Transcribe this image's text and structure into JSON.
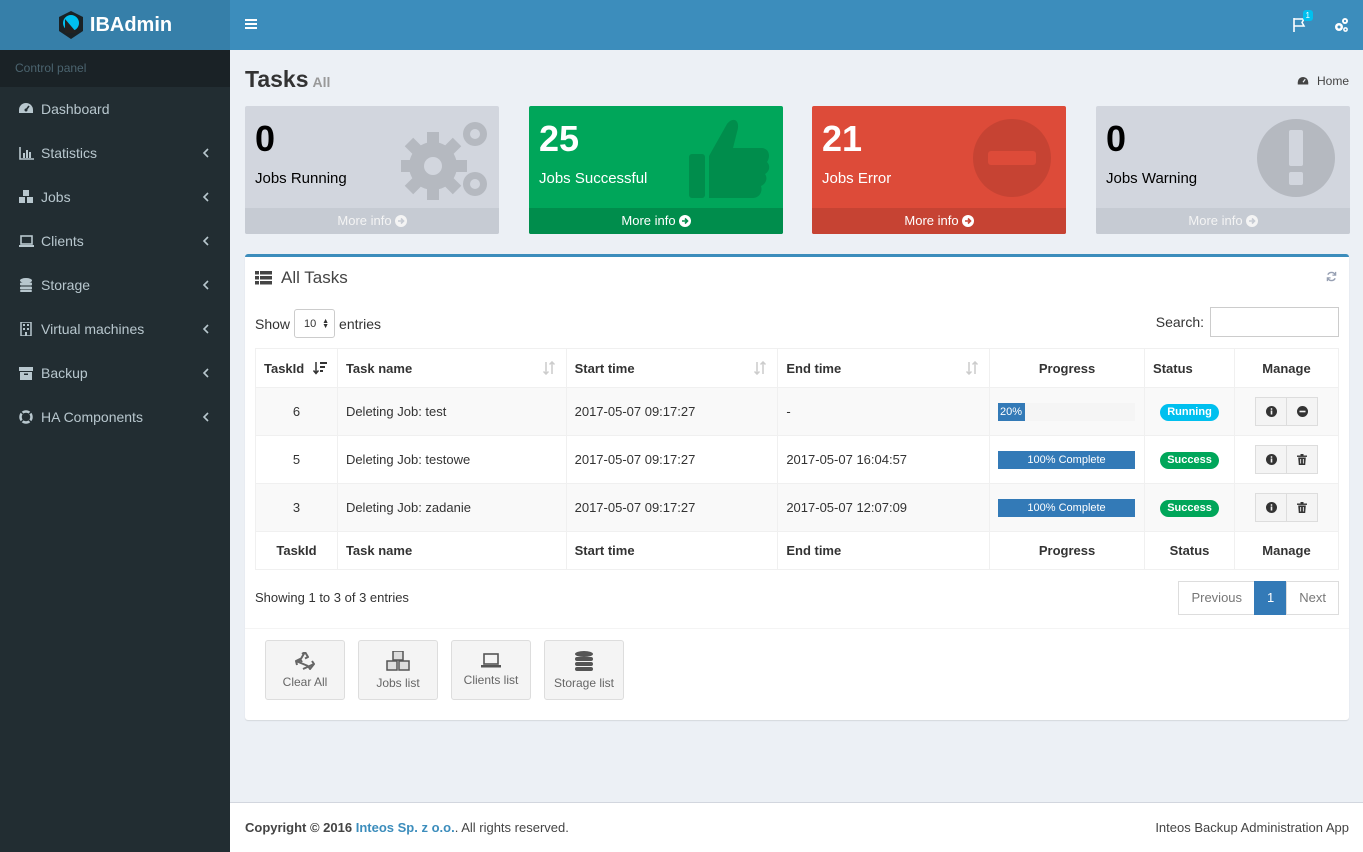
{
  "app": {
    "name": "IBAdmin"
  },
  "sidebar": {
    "header": "Control panel",
    "items": [
      {
        "label": "Dashboard",
        "icon": "dashboard-icon",
        "has_children": false
      },
      {
        "label": "Statistics",
        "icon": "bar-chart-icon",
        "has_children": true
      },
      {
        "label": "Jobs",
        "icon": "cubes-icon",
        "has_children": true
      },
      {
        "label": "Clients",
        "icon": "laptop-icon",
        "has_children": true
      },
      {
        "label": "Storage",
        "icon": "database-icon",
        "has_children": true
      },
      {
        "label": "Virtual machines",
        "icon": "building-icon",
        "has_children": true
      },
      {
        "label": "Backup",
        "icon": "archive-icon",
        "has_children": true
      },
      {
        "label": "HA Components",
        "icon": "life-ring-icon",
        "has_children": true
      }
    ]
  },
  "header": {
    "notification_count": "1"
  },
  "page": {
    "title": "Tasks",
    "subtitle": "All"
  },
  "breadcrumb": {
    "home": "Home"
  },
  "stats": [
    {
      "value": "0",
      "label": "Jobs Running",
      "more": "More info",
      "color": "#d2d6de",
      "icon": "gears-icon"
    },
    {
      "value": "25",
      "label": "Jobs Successful",
      "more": "More info",
      "color": "#00a65a",
      "icon": "thumbs-up-icon"
    },
    {
      "value": "21",
      "label": "Jobs Error",
      "more": "More info",
      "color": "#dd4b39",
      "icon": "minus-circle-icon"
    },
    {
      "value": "0",
      "label": "Jobs Warning",
      "more": "More info",
      "color": "#d2d6de",
      "icon": "exclamation-circle-icon"
    }
  ],
  "tasks_box": {
    "title": "All Tasks",
    "show_label": "Show",
    "entries_value": "10",
    "entries_label": "entries",
    "search_label": "Search:",
    "columns": [
      "TaskId",
      "Task name",
      "Start time",
      "End time",
      "Progress",
      "Status",
      "Manage"
    ],
    "rows": [
      {
        "id": "6",
        "name": "Deleting Job: test",
        "start": "2017-05-07 09:17:27",
        "end": "-",
        "progress": 20,
        "progress_label": "20%",
        "status": "Running"
      },
      {
        "id": "5",
        "name": "Deleting Job: testowe",
        "start": "2017-05-07 09:17:27",
        "end": "2017-05-07 16:04:57",
        "progress": 100,
        "progress_label": "100% Complete",
        "status": "Success"
      },
      {
        "id": "3",
        "name": "Deleting Job: zadanie",
        "start": "2017-05-07 09:17:27",
        "end": "2017-05-07 12:07:09",
        "progress": 100,
        "progress_label": "100% Complete",
        "status": "Success"
      }
    ],
    "showing": "Showing 1 to 3 of 3 entries",
    "pager": {
      "prev": "Previous",
      "current": "1",
      "next": "Next"
    },
    "actions": [
      {
        "label": "Clear All",
        "icon": "recycle-icon"
      },
      {
        "label": "Jobs list",
        "icon": "cubes-icon"
      },
      {
        "label": "Clients list",
        "icon": "laptop-icon"
      },
      {
        "label": "Storage list",
        "icon": "database-icon"
      }
    ]
  },
  "footer": {
    "copyright": "Copyright © 2016",
    "company": "Inteos Sp. z o.o.",
    "rights": ". All rights reserved.",
    "app_name": "Inteos Backup Administration App"
  }
}
